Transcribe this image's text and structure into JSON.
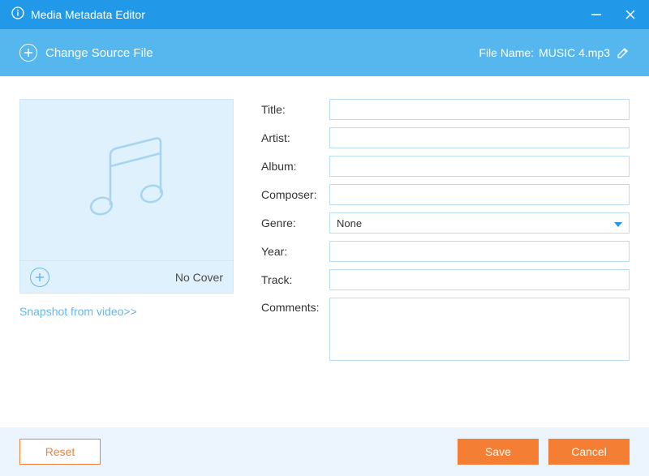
{
  "window": {
    "title": "Media Metadata Editor"
  },
  "toolbar": {
    "change_source_label": "Change Source File",
    "file_name_label": "File Name:",
    "file_name_value": "MUSIC 4.mp3"
  },
  "cover": {
    "no_cover_label": "No Cover",
    "snapshot_link": "Snapshot from video>>"
  },
  "form": {
    "title": {
      "label": "Title:",
      "value": ""
    },
    "artist": {
      "label": "Artist:",
      "value": ""
    },
    "album": {
      "label": "Album:",
      "value": ""
    },
    "composer": {
      "label": "Composer:",
      "value": ""
    },
    "genre": {
      "label": "Genre:",
      "value": "None"
    },
    "year": {
      "label": "Year:",
      "value": ""
    },
    "track": {
      "label": "Track:",
      "value": ""
    },
    "comments": {
      "label": "Comments:",
      "value": ""
    }
  },
  "footer": {
    "reset_label": "Reset",
    "save_label": "Save",
    "cancel_label": "Cancel"
  },
  "colors": {
    "primary": "#2199e8",
    "toolbar": "#56b6ee",
    "accent": "#f47e34",
    "border": "#b8ddf3",
    "footer_bg": "#ecf5fd"
  }
}
